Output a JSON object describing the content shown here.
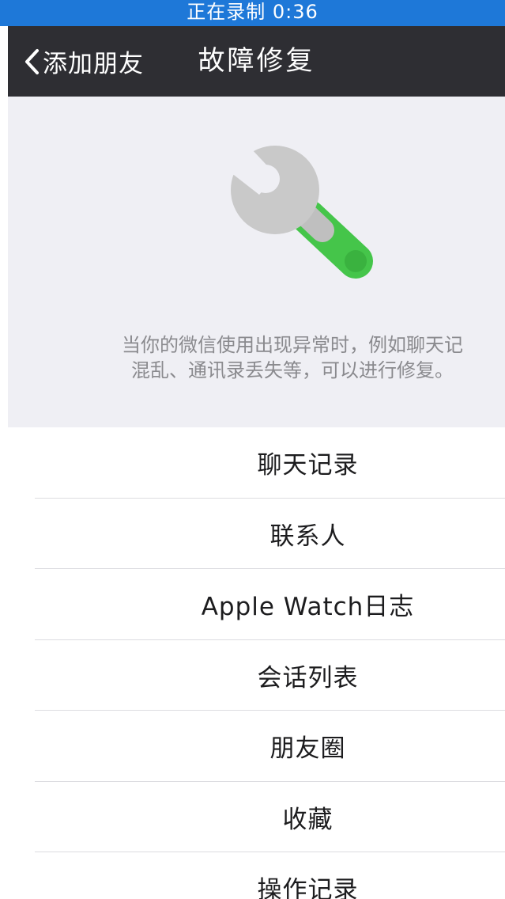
{
  "status_bar": {
    "text": "正在录制 0:36",
    "color": "#1e78d8"
  },
  "nav": {
    "back_label": "添加朋友",
    "title": "故障修复",
    "background": "#2e2e33"
  },
  "hero": {
    "icon": "wrench-icon",
    "description_line1": "当你的微信使用出现异常时，例如聊天记",
    "description_line2": "混乱、通讯录丢失等，可以进行修复。"
  },
  "repair_options": [
    {
      "label": "聊天记录"
    },
    {
      "label": "联系人"
    },
    {
      "label": "Apple Watch日志"
    },
    {
      "label": "会话列表"
    },
    {
      "label": "朋友圈"
    },
    {
      "label": "收藏"
    },
    {
      "label": "操作记录"
    }
  ]
}
